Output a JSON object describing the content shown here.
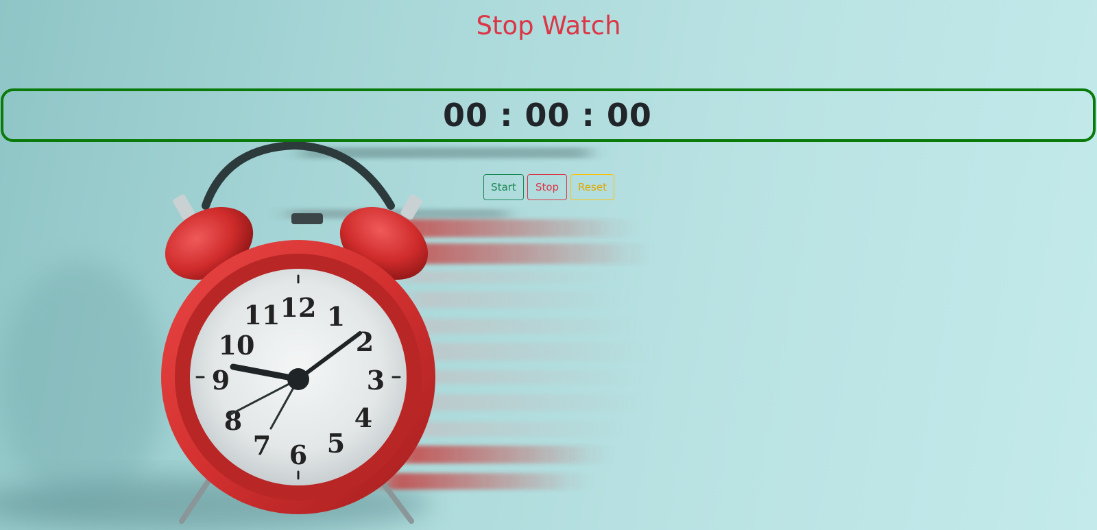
{
  "page": {
    "title": "Stop Watch"
  },
  "display": {
    "time": "00 : 00 : 00"
  },
  "buttons": {
    "start_label": "Start",
    "stop_label": "Stop",
    "reset_label": "Reset"
  },
  "clock_face": {
    "numerals": [
      "12",
      "1",
      "2",
      "3",
      "4",
      "5",
      "6",
      "7",
      "8",
      "9",
      "10",
      "11"
    ]
  },
  "colors": {
    "title": "#dc3545",
    "display_border": "#0a7a0a",
    "start": "#198754",
    "stop": "#dc3545",
    "reset": "#ffc107"
  }
}
